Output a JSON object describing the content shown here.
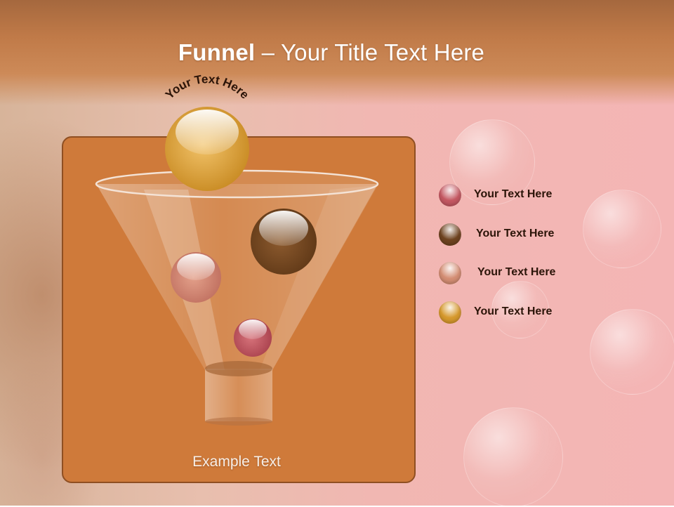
{
  "title": {
    "bold": "Funnel",
    "separator": " – ",
    "rest": "Your Title Text Here"
  },
  "arc_text": "Your Text Here",
  "example_text": "Example Text",
  "legend": [
    {
      "label": "Your  Text Here",
      "color": "#c45862"
    },
    {
      "label": "Your  Text Here",
      "color": "#6e4320"
    },
    {
      "label": "Your  Text Here",
      "color": "#d48e74"
    },
    {
      "label": "Your  Text Here",
      "color": "#d6992d"
    }
  ],
  "colors": {
    "panel": "#cf7a3a",
    "panel_border": "#8f4f22",
    "header": "#c07a48",
    "background": "#f4b5b5"
  }
}
